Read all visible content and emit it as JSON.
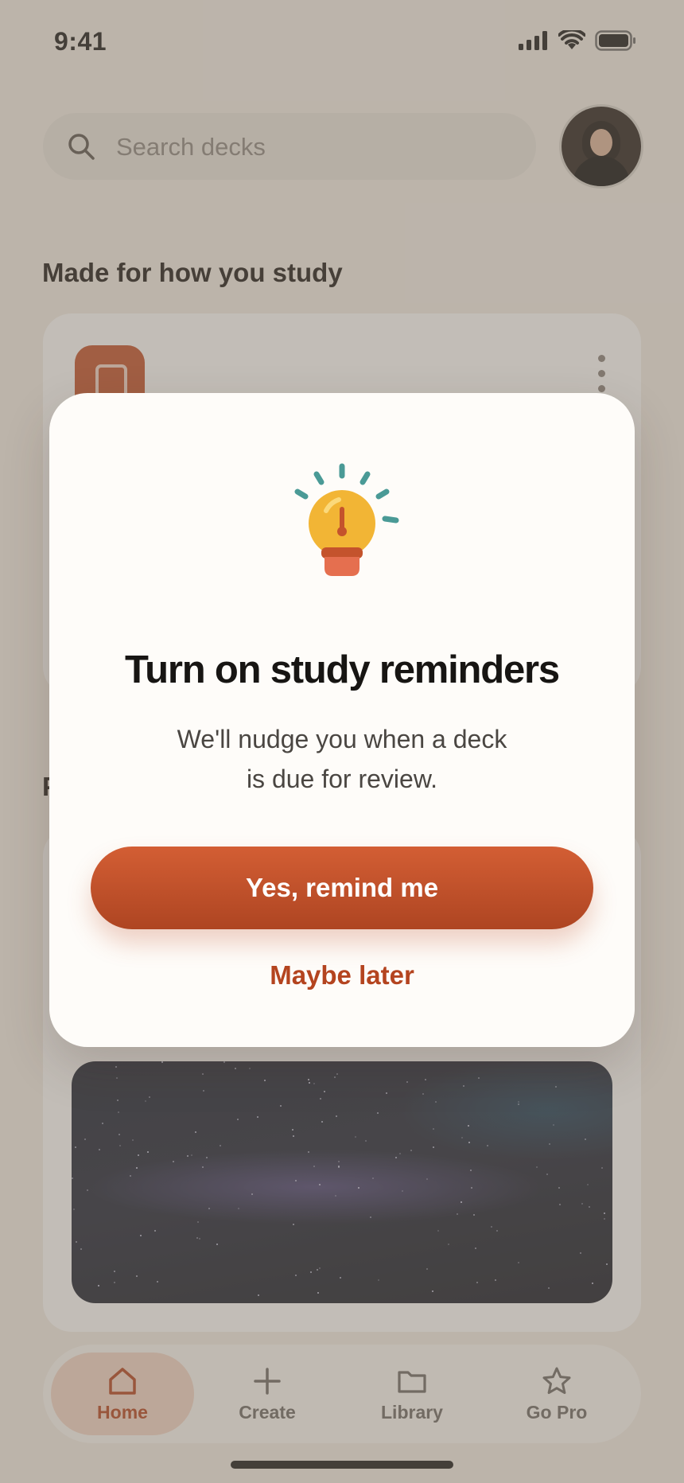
{
  "status_bar": {
    "time": "9:41"
  },
  "search": {
    "placeholder": "Search decks"
  },
  "sections": {
    "made_for_you": "Made for how you study",
    "second_title": "P"
  },
  "modal": {
    "title": "Turn on study reminders",
    "body_line_1": "We'll nudge you when a deck",
    "body_line_2": "is due for review.",
    "primary_label": "Yes, remind me",
    "secondary_label": "Maybe later"
  },
  "tab_bar": {
    "items": [
      {
        "label": "Home",
        "icon": "home-icon",
        "active": true
      },
      {
        "label": "Create",
        "icon": "plus-icon",
        "active": false
      },
      {
        "label": "Library",
        "icon": "folder-icon",
        "active": false
      },
      {
        "label": "Go Pro",
        "icon": "star-icon",
        "active": false
      }
    ]
  },
  "colors": {
    "accent": "#C4532C",
    "accent_dark": "#AE4522",
    "scrim": "#786C60",
    "modal_bg": "#FEFCF9"
  }
}
